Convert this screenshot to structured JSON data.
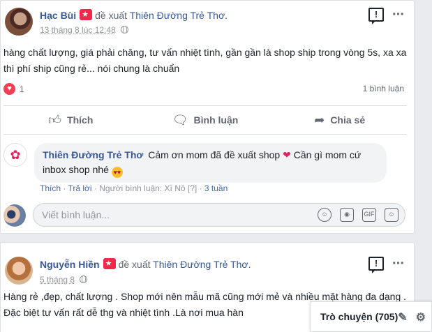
{
  "post1": {
    "author": "Hạc Bùi",
    "recommend_text": "đề xuất",
    "page_name": "Thiên Đường Trẻ Thơ.",
    "timestamp": "13 tháng 8 lúc 12:48",
    "text": "hàng chất lượng, giá phải chăng, tư vấn nhiệt tình, gần gần là shop ship trong vòng 5s, xa xa thì phí ship cũng rẻ... nói chung là chuẩn",
    "reaction_count": "1",
    "comment_count": "1 bình luận",
    "actions": [
      "Thích",
      "Bình luận",
      "Chia sẻ"
    ],
    "comment": {
      "author": "Thiên Đường Trẻ Thơ",
      "text_before_heart": "Cảm ơn mom đã đề xuất shop",
      "text_after_heart": "Cần gì mom cứ inbox shop nhé",
      "like": "Thích",
      "reply": "Trả lời",
      "commenter_label": "Người bình luận: Xì Nô",
      "age": "3 tuần"
    },
    "composer_placeholder": "Viết bình luận..."
  },
  "post2": {
    "author": "Nguyễn Hiền",
    "recommend_text": "đề xuất",
    "page_name": "Thiên Đường Trẻ Thơ.",
    "timestamp": "5 tháng 8",
    "text": "Hàng rẻ ,đẹp, chất lượng . Shop mới nên mẫu mã cũng mới mẻ và nhiều mặt hàng đa dạng . Đặc biệt tư vấn rất dễ thg và nhiệt tình .Là nơi mua hàn"
  },
  "chat": {
    "label": "Trò chuyện (705)"
  },
  "icons": {
    "heart": "heart-icon",
    "globe": "globe-icon",
    "like": "thumbs-up-icon",
    "comment": "speech-bubble-icon",
    "share": "share-arrow-icon"
  }
}
